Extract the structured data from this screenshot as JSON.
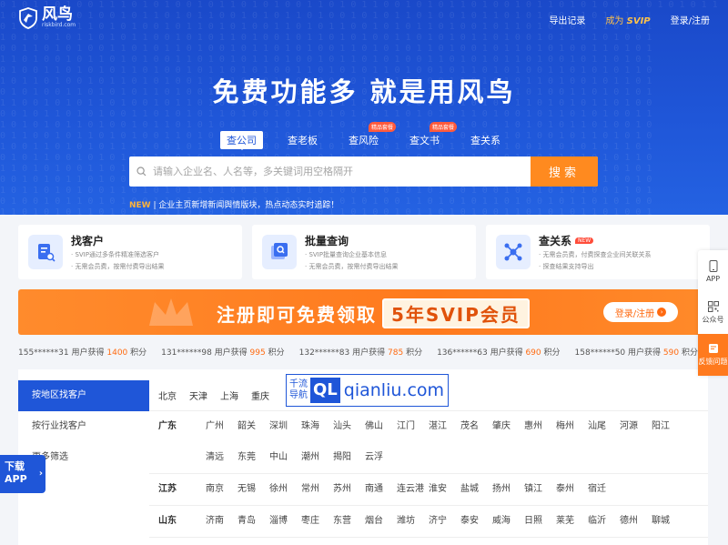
{
  "brand": {
    "name": "风鸟",
    "domain": "riskbird.com"
  },
  "nav": {
    "export": "导出记录",
    "svip_prefix": "成为",
    "svip_word": "SVIP",
    "login": "登录/注册"
  },
  "slogan": "免费功能多  就是用风鸟",
  "tabs": [
    {
      "label": "查公司",
      "badge": ""
    },
    {
      "label": "查老板",
      "badge": ""
    },
    {
      "label": "查风险",
      "badge": "精品套餐"
    },
    {
      "label": "查文书",
      "badge": "精品套餐"
    },
    {
      "label": "查关系",
      "badge": ""
    }
  ],
  "search": {
    "placeholder": "请输入企业名、人名等，多关键词用空格隔开",
    "button": "搜索"
  },
  "notice": {
    "new": "NEW",
    "text": "企业主页新增新闻舆情版块，热点动态实时追踪！"
  },
  "cards": [
    {
      "title": "找客户",
      "badge": "",
      "desc1": "· SVIP通过多条件精准筛选客户",
      "desc2": "· 无需会员费，按需付费导出结果"
    },
    {
      "title": "批量查询",
      "badge": "",
      "desc1": "· SVIP批量查询企业基本信息",
      "desc2": "· 无需会员费，按需付费导出结果"
    },
    {
      "title": "查关系",
      "badge": "NEW",
      "desc1": "· 无需会员费，付费探查企业间关联关系",
      "desc2": "· 探查结果支持导出"
    }
  ],
  "banner": {
    "text": "注册即可免费领取",
    "svip": "5年SVIP会员",
    "button": "登录/注册"
  },
  "ticker": [
    {
      "user": "155******31 用户获得",
      "pts": "1400",
      "unit": "积分"
    },
    {
      "user": "131******98 用户获得",
      "pts": "995",
      "unit": "积分"
    },
    {
      "user": "132******83 用户获得",
      "pts": "785",
      "unit": "积分"
    },
    {
      "user": "136******63 用户获得",
      "pts": "690",
      "unit": "积分"
    },
    {
      "user": "158******50 用户获得",
      "pts": "590",
      "unit": "积分"
    }
  ],
  "region": {
    "sidebar": [
      "按地区找客户",
      "按行业找客户",
      "更多筛选"
    ],
    "hot": [
      "北京",
      "天津",
      "上海",
      "重庆"
    ],
    "provinces": [
      {
        "name": "广东",
        "cities": [
          "广州",
          "韶关",
          "深圳",
          "珠海",
          "汕头",
          "佛山",
          "江门",
          "湛江",
          "茂名",
          "肇庆",
          "惠州",
          "梅州",
          "汕尾",
          "河源",
          "阳江",
          "清远",
          "东莞",
          "中山",
          "潮州",
          "揭阳",
          "云浮"
        ]
      },
      {
        "name": "江苏",
        "cities": [
          "南京",
          "无锡",
          "徐州",
          "常州",
          "苏州",
          "南通",
          "连云港",
          "淮安",
          "盐城",
          "扬州",
          "镇江",
          "泰州",
          "宿迁"
        ]
      },
      {
        "name": "山东",
        "cities": [
          "济南",
          "青岛",
          "淄博",
          "枣庄",
          "东营",
          "烟台",
          "潍坊",
          "济宁",
          "泰安",
          "威海",
          "日照",
          "莱芜",
          "临沂",
          "德州",
          "聊城"
        ]
      }
    ]
  },
  "watermark": {
    "a1": "千流",
    "a2": "导航",
    "b": "QL",
    "c": "qianliu.com"
  },
  "rightfloat": [
    "APP",
    "公众号",
    "反馈问题"
  ],
  "leftfloat": {
    "l1": "下载",
    "l2": "APP"
  }
}
